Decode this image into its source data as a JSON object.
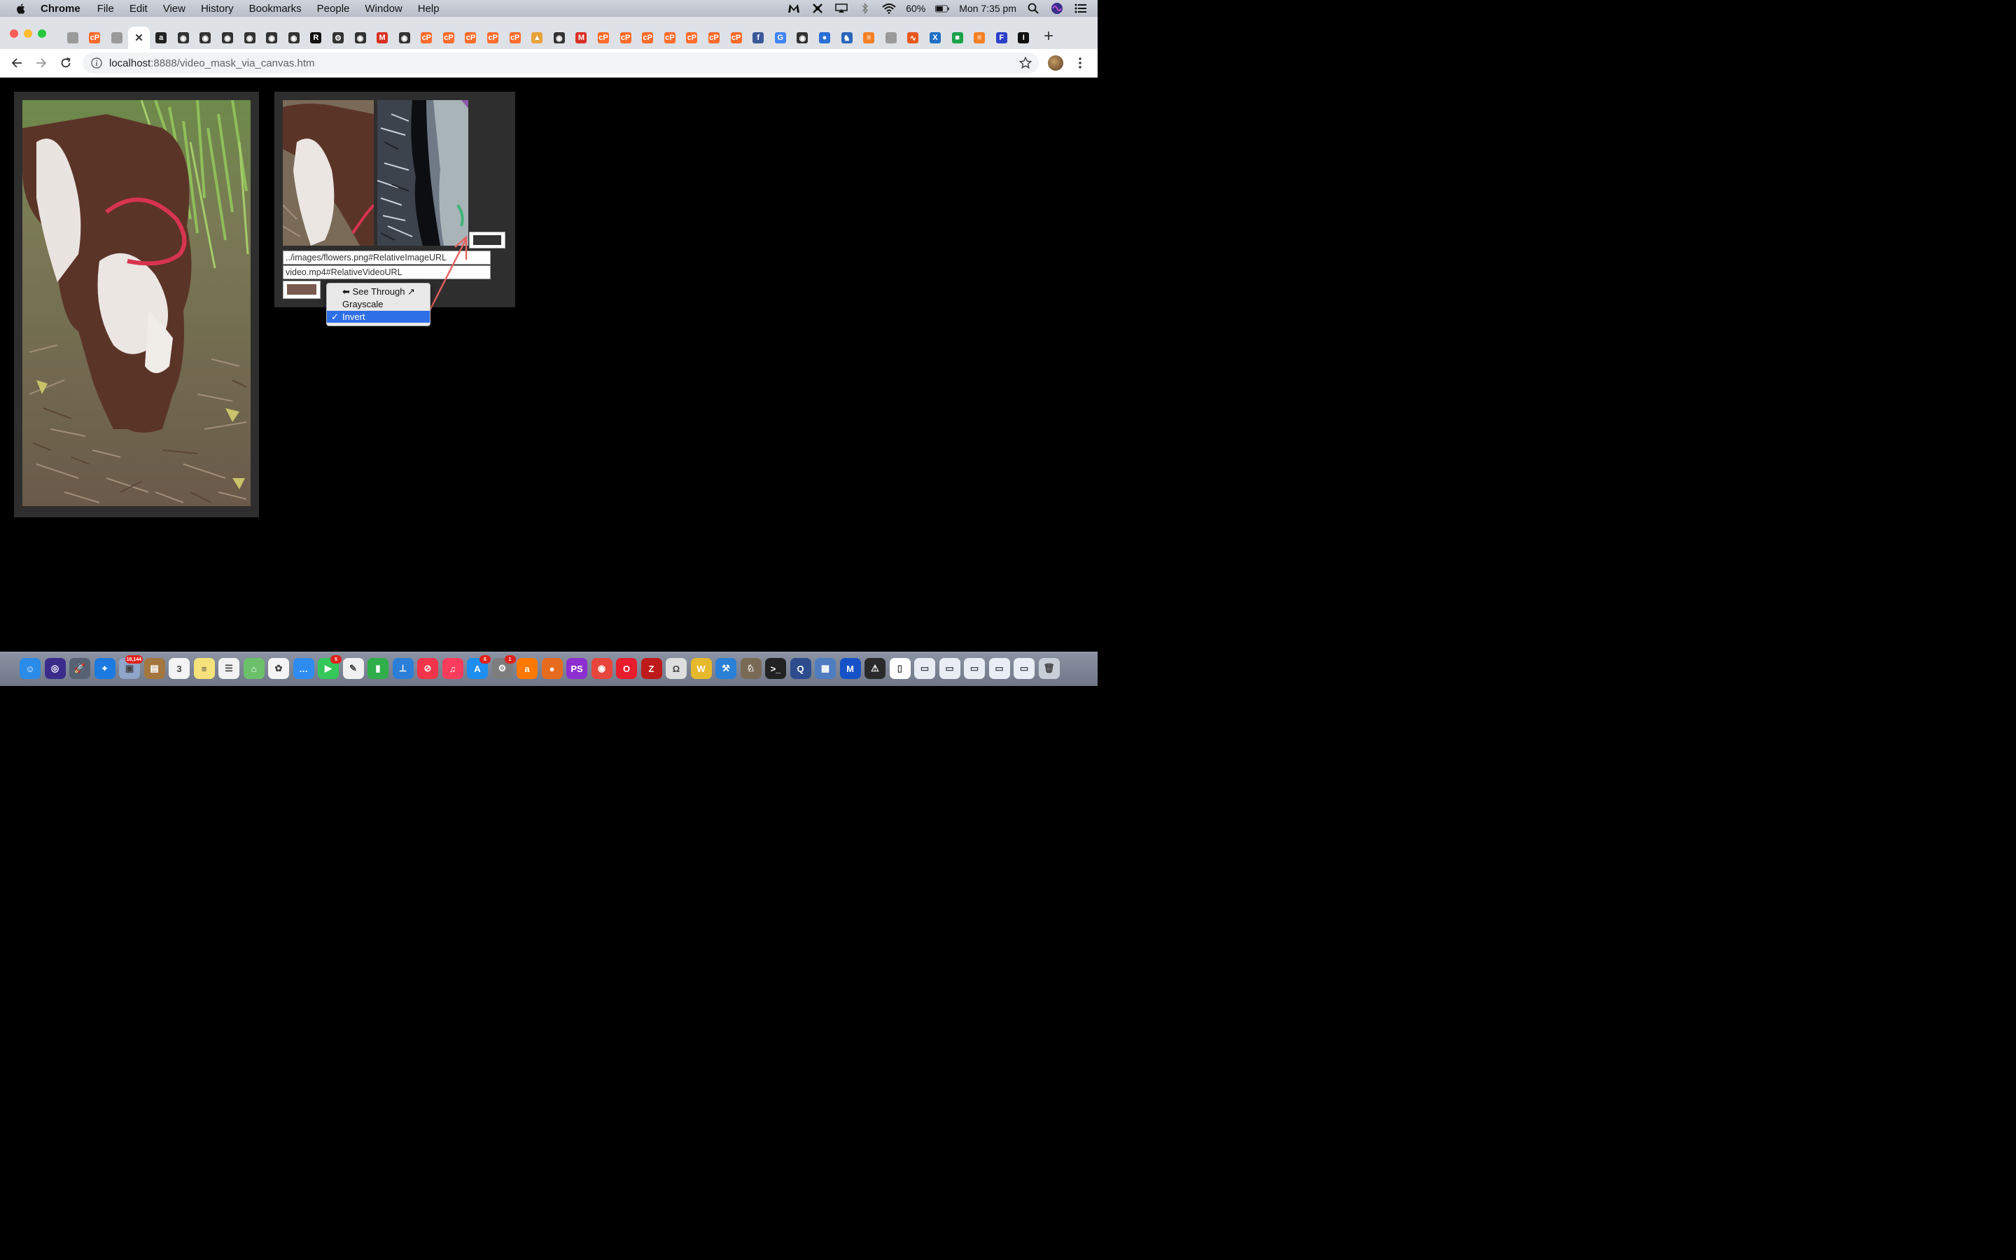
{
  "menubar": {
    "app": "Chrome",
    "items": [
      "File",
      "Edit",
      "View",
      "History",
      "Bookmarks",
      "People",
      "Window",
      "Help"
    ],
    "battery": "60%",
    "clock": "Mon 7:35 pm"
  },
  "tabs": [
    {
      "icon": "image-favicon",
      "color": "#9a9a9a",
      "glyph": ""
    },
    {
      "icon": "cpanel-favicon",
      "color": "#ff6c2c",
      "glyph": "cP"
    },
    {
      "icon": "image-favicon",
      "color": "#9a9a9a",
      "glyph": ""
    },
    {
      "icon": "close-icon",
      "color": "#ffffff",
      "glyph": "✕",
      "active": true
    },
    {
      "icon": "amazon-favicon",
      "color": "#222222",
      "glyph": "a"
    },
    {
      "icon": "globe-icon",
      "color": "#333333",
      "glyph": "◉"
    },
    {
      "icon": "globe-icon",
      "color": "#333333",
      "glyph": "◉"
    },
    {
      "icon": "globe-icon",
      "color": "#333333",
      "glyph": "◉"
    },
    {
      "icon": "globe-icon",
      "color": "#333333",
      "glyph": "◉"
    },
    {
      "icon": "globe-icon",
      "color": "#333333",
      "glyph": "◉"
    },
    {
      "icon": "globe-icon",
      "color": "#333333",
      "glyph": "◉"
    },
    {
      "icon": "regex-favicon",
      "color": "#111111",
      "glyph": "R"
    },
    {
      "icon": "gear-icon",
      "color": "#333333",
      "glyph": "⚙"
    },
    {
      "icon": "globe-icon",
      "color": "#333333",
      "glyph": "◉"
    },
    {
      "icon": "gmail-favicon",
      "color": "#d93025",
      "glyph": "M"
    },
    {
      "icon": "globe-icon",
      "color": "#333333",
      "glyph": "◉"
    },
    {
      "icon": "cpanel-favicon",
      "color": "#ff6c2c",
      "glyph": "cP"
    },
    {
      "icon": "cpanel-favicon",
      "color": "#ff6c2c",
      "glyph": "cP"
    },
    {
      "icon": "cpanel-favicon",
      "color": "#ff6c2c",
      "glyph": "cP"
    },
    {
      "icon": "cpanel-favicon",
      "color": "#ff6c2c",
      "glyph": "cP"
    },
    {
      "icon": "cpanel-favicon",
      "color": "#ff6c2c",
      "glyph": "cP"
    },
    {
      "icon": "phpmyadmin-favicon",
      "color": "#e8a33b",
      "glyph": "▲"
    },
    {
      "icon": "globe-icon",
      "color": "#333333",
      "glyph": "◉"
    },
    {
      "icon": "gmail-favicon",
      "color": "#d93025",
      "glyph": "M"
    },
    {
      "icon": "cpanel-favicon",
      "color": "#ff6c2c",
      "glyph": "cP"
    },
    {
      "icon": "cpanel-favicon",
      "color": "#ff6c2c",
      "glyph": "cP"
    },
    {
      "icon": "cpanel-favicon",
      "color": "#ff6c2c",
      "glyph": "cP"
    },
    {
      "icon": "cpanel-favicon",
      "color": "#ff6c2c",
      "glyph": "cP"
    },
    {
      "icon": "cpanel-favicon",
      "color": "#ff6c2c",
      "glyph": "cP"
    },
    {
      "icon": "cpanel-favicon",
      "color": "#ff6c2c",
      "glyph": "cP"
    },
    {
      "icon": "cpanel-favicon",
      "color": "#ff6c2c",
      "glyph": "cP"
    },
    {
      "icon": "facebook-favicon",
      "color": "#3b5998",
      "glyph": "f"
    },
    {
      "icon": "google-favicon",
      "color": "#4285f4",
      "glyph": "G"
    },
    {
      "icon": "globe-icon",
      "color": "#333333",
      "glyph": "◉"
    },
    {
      "icon": "firefox-favicon",
      "color": "#2a6fd6",
      "glyph": "●"
    },
    {
      "icon": "person-favicon",
      "color": "#2966b8",
      "glyph": "♞"
    },
    {
      "icon": "stackoverflow-favicon",
      "color": "#f48024",
      "glyph": "≡"
    },
    {
      "icon": "image-favicon",
      "color": "#9a9a9a",
      "glyph": ""
    },
    {
      "icon": "chart-favicon",
      "color": "#e8581f",
      "glyph": "∿"
    },
    {
      "icon": "x-favicon",
      "color": "#1f6fc5",
      "glyph": "X"
    },
    {
      "icon": "cube-favicon",
      "color": "#1aa34a",
      "glyph": "■"
    },
    {
      "icon": "stackoverflow-favicon",
      "color": "#f48024",
      "glyph": "≡"
    },
    {
      "icon": "f-favicon",
      "color": "#2b3fc9",
      "glyph": "F"
    },
    {
      "icon": "i-favicon",
      "color": "#111111",
      "glyph": "I"
    }
  ],
  "address": {
    "host": "localhost",
    "rest": ":8888/video_mask_via_canvas.htm"
  },
  "form": {
    "image_url": "../images/flowers.png#RelativeImageURL",
    "video_url": "video.mp4#RelativeVideoURL"
  },
  "dropdown": {
    "options": [
      {
        "label": "⬅ See Through ↗",
        "selected": false
      },
      {
        "label": "Grayscale",
        "selected": false
      },
      {
        "label": "Invert",
        "selected": true
      }
    ],
    "check": "✓"
  },
  "colors": {
    "swatch": "#7a5a4e",
    "swatch_small": "#333333",
    "panel": "#2e2e2e",
    "arrow": "#e86060"
  },
  "dock": [
    {
      "icon": "finder-icon",
      "color": "#2b8be8",
      "glyph": "☺"
    },
    {
      "icon": "siri-icon",
      "color": "#3b2c8c",
      "glyph": "◎"
    },
    {
      "icon": "launchpad-icon",
      "color": "#566273",
      "glyph": "🚀"
    },
    {
      "icon": "safari-icon",
      "color": "#1d7ae0",
      "glyph": "⌖"
    },
    {
      "icon": "preview-icon",
      "color": "#8fa5c9",
      "glyph": "▣",
      "badge": "18,144"
    },
    {
      "icon": "notes-brown-icon",
      "color": "#a4773f",
      "glyph": "▤"
    },
    {
      "icon": "calendar-icon",
      "color": "#f4f4f4",
      "glyph": "3"
    },
    {
      "icon": "notes-icon",
      "color": "#f6e27a",
      "glyph": "≡"
    },
    {
      "icon": "reminders-icon",
      "color": "#f2f2f2",
      "glyph": "☰"
    },
    {
      "icon": "maps-icon",
      "color": "#6cc06a",
      "glyph": "⌂"
    },
    {
      "icon": "photos-icon",
      "color": "#f4f4f4",
      "glyph": "✿"
    },
    {
      "icon": "messages-icon",
      "color": "#2e8cf0",
      "glyph": "…"
    },
    {
      "icon": "facetime-icon",
      "color": "#34c759",
      "glyph": "▶",
      "badge": "5"
    },
    {
      "icon": "textedit-icon",
      "color": "#f0f0f0",
      "glyph": "✎"
    },
    {
      "icon": "numbers-icon",
      "color": "#2fae4a",
      "glyph": "▮"
    },
    {
      "icon": "keynote-icon",
      "color": "#2c7fd8",
      "glyph": "⊥"
    },
    {
      "icon": "news-icon",
      "color": "#f2344a",
      "glyph": "⊘"
    },
    {
      "icon": "music-icon",
      "color": "#fc3c5c",
      "glyph": "♫"
    },
    {
      "icon": "appstore-icon",
      "color": "#1d8ff0",
      "glyph": "A",
      "badge": "6"
    },
    {
      "icon": "settings-icon",
      "color": "#7d7d7d",
      "glyph": "⚙",
      "badge": "1"
    },
    {
      "icon": "avast-icon",
      "color": "#ff7800",
      "glyph": "a"
    },
    {
      "icon": "firefox-icon",
      "color": "#e66b1f",
      "glyph": "●"
    },
    {
      "icon": "phpstorm-icon",
      "color": "#8d2fd0",
      "glyph": "PS"
    },
    {
      "icon": "chrome-icon",
      "color": "#e8453c",
      "glyph": "◉"
    },
    {
      "icon": "opera-icon",
      "color": "#e81c2c",
      "glyph": "O"
    },
    {
      "icon": "filezilla-icon",
      "color": "#bf1a1a",
      "glyph": "Z"
    },
    {
      "icon": "sequel-icon",
      "color": "#dedede",
      "glyph": "Ω"
    },
    {
      "icon": "wireshark-icon",
      "color": "#e6b92c",
      "glyph": "W"
    },
    {
      "icon": "xcode-icon",
      "color": "#2a7fd6",
      "glyph": "⚒"
    },
    {
      "icon": "gimp-icon",
      "color": "#7a6a55",
      "glyph": "♘"
    },
    {
      "icon": "terminal-icon",
      "color": "#222222",
      "glyph": ">_"
    },
    {
      "icon": "quicktime-icon",
      "color": "#2d4c8e",
      "glyph": "Q"
    },
    {
      "icon": "preview-app-icon",
      "color": "#4f7dc2",
      "glyph": "▦"
    },
    {
      "icon": "malwarebytes-icon",
      "color": "#1652c7",
      "glyph": "M"
    },
    {
      "icon": "console-icon",
      "color": "#2a2a2a",
      "glyph": "⚠"
    },
    {
      "icon": "document-icon",
      "color": "#ffffff",
      "glyph": "▯"
    },
    {
      "icon": "document-icon",
      "color": "#e9eef5",
      "glyph": "▭"
    },
    {
      "icon": "document-icon",
      "color": "#e9eef5",
      "glyph": "▭"
    },
    {
      "icon": "document-icon",
      "color": "#e9eef5",
      "glyph": "▭"
    },
    {
      "icon": "document-icon",
      "color": "#e9eef5",
      "glyph": "▭"
    },
    {
      "icon": "document-icon",
      "color": "#e9eef5",
      "glyph": "▭"
    },
    {
      "icon": "trash-icon",
      "color": "#c9cfd8",
      "glyph": "🗑"
    }
  ]
}
